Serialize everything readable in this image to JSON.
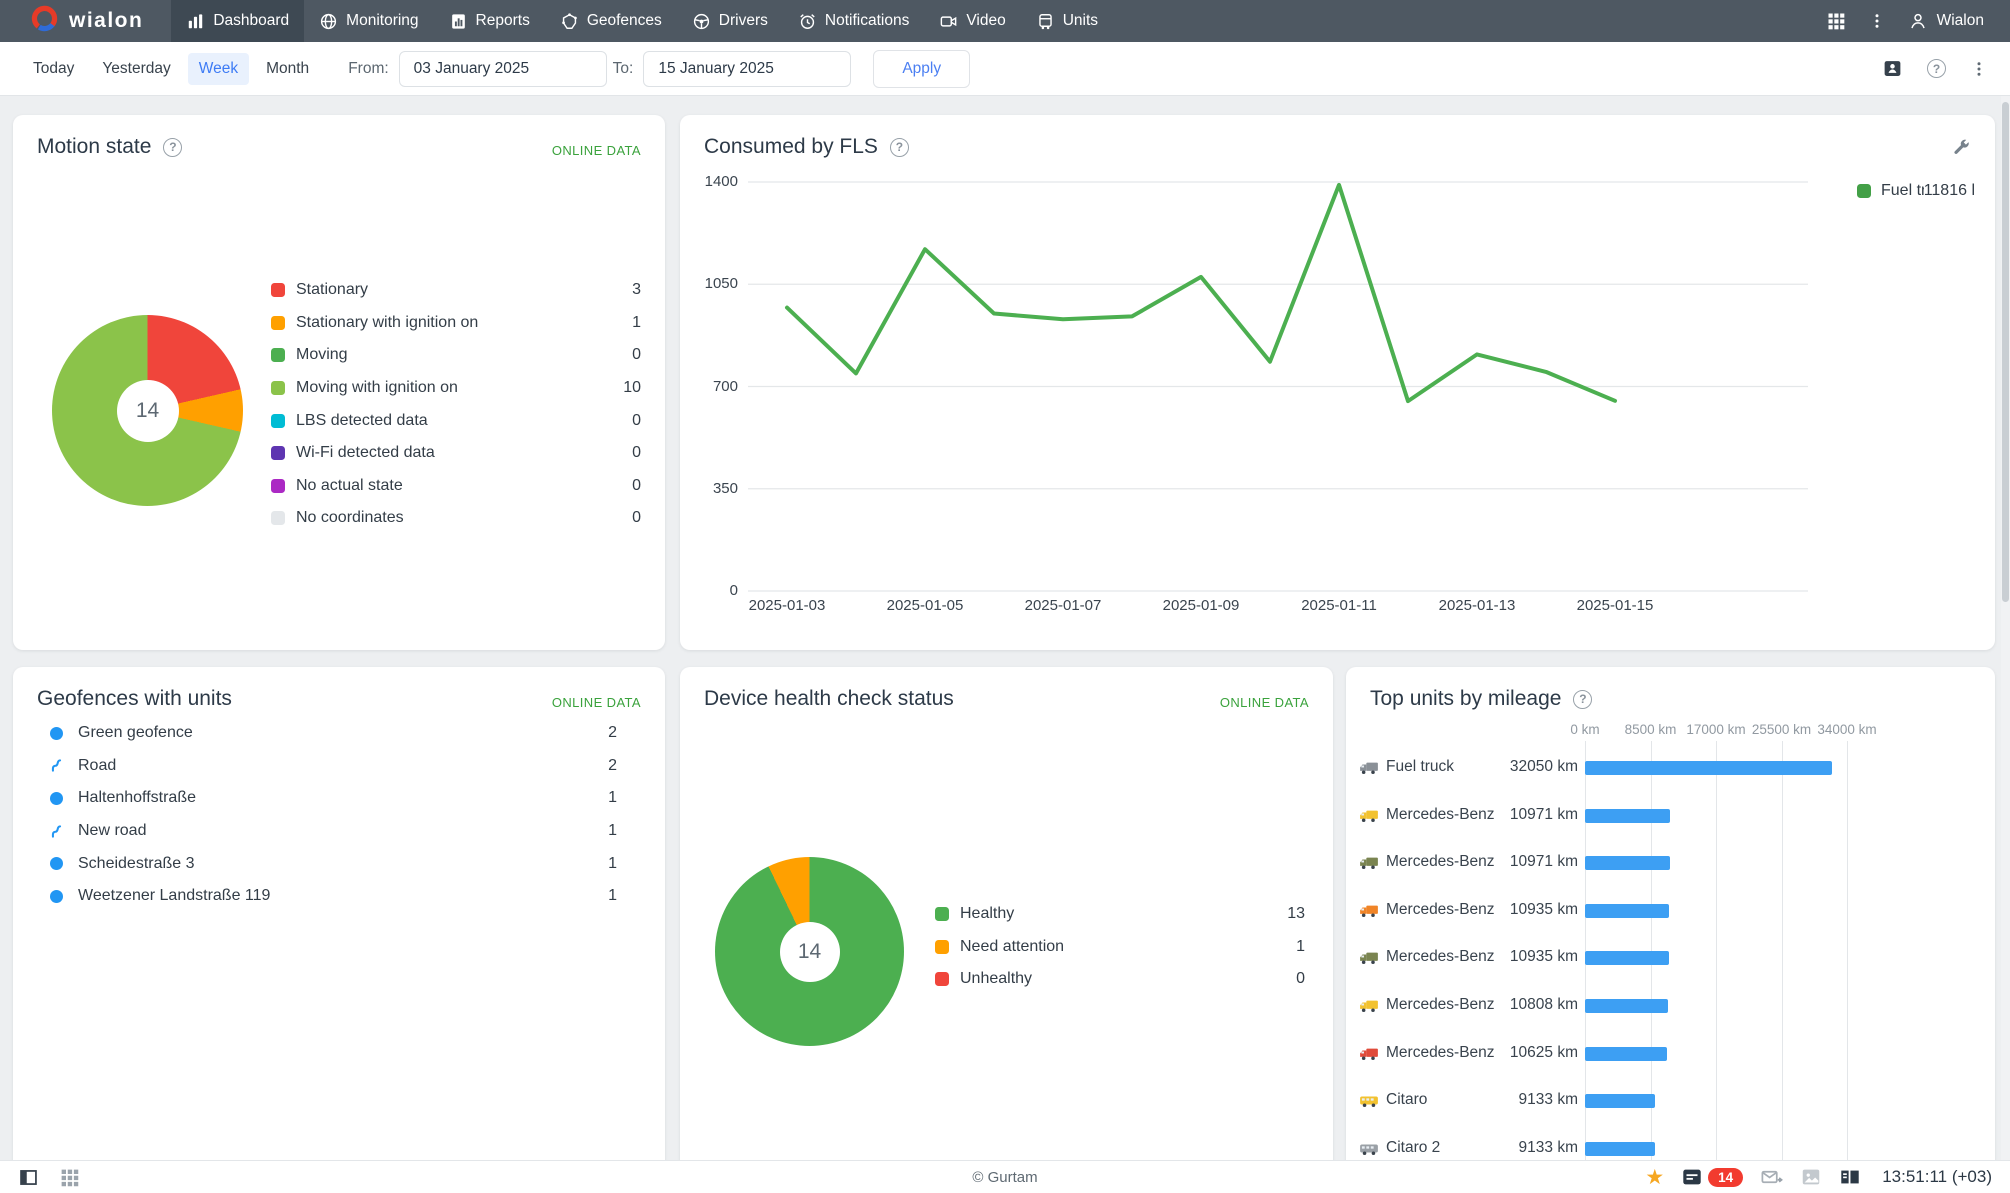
{
  "nav": {
    "brand": "wialon",
    "items": [
      {
        "label": "Dashboard",
        "icon": "dashboard",
        "active": true
      },
      {
        "label": "Monitoring",
        "icon": "monitoring",
        "active": false
      },
      {
        "label": "Reports",
        "icon": "reports",
        "active": false
      },
      {
        "label": "Geofences",
        "icon": "geofences",
        "active": false
      },
      {
        "label": "Drivers",
        "icon": "drivers",
        "active": false
      },
      {
        "label": "Notifications",
        "icon": "notifications",
        "active": false
      },
      {
        "label": "Video",
        "icon": "video",
        "active": false
      },
      {
        "label": "Units",
        "icon": "units",
        "active": false
      }
    ],
    "user_label": "Wialon"
  },
  "filter_bar": {
    "presets": [
      {
        "label": "Today",
        "active": false
      },
      {
        "label": "Yesterday",
        "active": false
      },
      {
        "label": "Week",
        "active": true
      },
      {
        "label": "Month",
        "active": false
      }
    ],
    "from_label": "From:",
    "from_value": "03 January 2025",
    "to_label": "To:",
    "to_value": "15 January 2025",
    "apply_label": "Apply"
  },
  "cards": {
    "motion_state": {
      "title": "Motion state",
      "online_label": "ONLINE DATA",
      "center_label": "14",
      "legend": [
        {
          "label": "Stationary",
          "value": "3",
          "color": "#f0453b"
        },
        {
          "label": "Stationary with ignition on",
          "value": "1",
          "color": "#ffa000"
        },
        {
          "label": "Moving",
          "value": "0",
          "color": "#4caf50"
        },
        {
          "label": "Moving with ignition on",
          "value": "10",
          "color": "#8bc34a"
        },
        {
          "label": "LBS detected data",
          "value": "0",
          "color": "#00bcd4"
        },
        {
          "label": "Wi-Fi detected data",
          "value": "0",
          "color": "#5e35b1"
        },
        {
          "label": "No actual state",
          "value": "0",
          "color": "#ab29c4"
        },
        {
          "label": "No coordinates",
          "value": "0",
          "color": "#e4e7ea"
        }
      ]
    },
    "consumed_fls": {
      "title": "Consumed by FLS",
      "legend_name": "Fuel truck",
      "legend_value": "11816 l",
      "line_color": "#4caf50",
      "dates": [
        "2025-01-03",
        "2025-01-04",
        "2025-01-05",
        "2025-01-06",
        "2025-01-07",
        "2025-01-08",
        "2025-01-09",
        "2025-01-10",
        "2025-01-11",
        "2025-01-12",
        "2025-01-13",
        "2025-01-14",
        "2025-01-15"
      ],
      "values": [
        970,
        745,
        1170,
        950,
        930,
        940,
        1075,
        785,
        1390,
        650,
        810,
        750,
        651
      ],
      "yticks": [
        1400,
        1050,
        700,
        350,
        0
      ]
    },
    "geofences": {
      "title": "Geofences with units",
      "online_label": "ONLINE DATA",
      "rows": [
        {
          "icon": "circle",
          "label": "Green geofence",
          "value": "2"
        },
        {
          "icon": "route",
          "label": "Road",
          "value": "2"
        },
        {
          "icon": "circle",
          "label": "Haltenhoffstraße",
          "value": "1"
        },
        {
          "icon": "route",
          "label": "New road",
          "value": "1"
        },
        {
          "icon": "circle",
          "label": "Scheidestraße 3",
          "value": "1"
        },
        {
          "icon": "circle",
          "label": "Weetzener Landstraße 119",
          "value": "1"
        }
      ]
    },
    "device_health": {
      "title": "Device health check status",
      "online_label": "ONLINE DATA",
      "center_label": "14",
      "legend": [
        {
          "label": "Healthy",
          "value": "13",
          "color": "#4caf50"
        },
        {
          "label": "Need attention",
          "value": "1",
          "color": "#ffa000"
        },
        {
          "label": "Unhealthy",
          "value": "0",
          "color": "#f0453b"
        }
      ]
    },
    "top_mileage": {
      "title": "Top units by mileage",
      "xticks": [
        "0 km",
        "8500 km",
        "17000 km",
        "25500 km",
        "34000 km"
      ],
      "xmax": 34000,
      "bar_color": "#3d9ff3",
      "rows": [
        {
          "label": "Fuel truck",
          "value": "32050 km",
          "km": 32050,
          "vehicle": "truck",
          "icon_color": "#8a9097"
        },
        {
          "label": "Mercedes-Benz",
          "value": "10971 km",
          "km": 10971,
          "vehicle": "truck",
          "icon_color": "#f2c230"
        },
        {
          "label": "Mercedes-Benz",
          "value": "10971 km",
          "km": 10971,
          "vehicle": "truck",
          "icon_color": "#7a8450"
        },
        {
          "label": "Mercedes-Benz",
          "value": "10935 km",
          "km": 10935,
          "vehicle": "truck",
          "icon_color": "#f08427"
        },
        {
          "label": "Mercedes-Benz",
          "value": "10935 km",
          "km": 10935,
          "vehicle": "truck",
          "icon_color": "#7a8450"
        },
        {
          "label": "Mercedes-Benz",
          "value": "10808 km",
          "km": 10808,
          "vehicle": "truck",
          "icon_color": "#f2c230"
        },
        {
          "label": "Mercedes-Benz",
          "value": "10625 km",
          "km": 10625,
          "vehicle": "truck",
          "icon_color": "#e04b3a"
        },
        {
          "label": "Citaro",
          "value": "9133 km",
          "km": 9133,
          "vehicle": "bus",
          "icon_color": "#f2c230"
        },
        {
          "label": "Citaro 2",
          "value": "9133 km",
          "km": 9133,
          "vehicle": "bus",
          "icon_color": "#9aa0a6"
        }
      ]
    }
  },
  "footer": {
    "copyright": "© Gurtam",
    "badge": "14",
    "time": "13:51:11 (+03)"
  },
  "chart_data": [
    {
      "type": "pie",
      "title": "Motion state",
      "labels": [
        "Stationary",
        "Stationary with ignition on",
        "Moving",
        "Moving with ignition on",
        "LBS detected data",
        "Wi-Fi detected data",
        "No actual state",
        "No coordinates"
      ],
      "values": [
        3,
        1,
        0,
        10,
        0,
        0,
        0,
        0
      ],
      "center_label": "14"
    },
    {
      "type": "line",
      "title": "Consumed by FLS",
      "x": [
        "2025-01-03",
        "2025-01-04",
        "2025-01-05",
        "2025-01-06",
        "2025-01-07",
        "2025-01-08",
        "2025-01-09",
        "2025-01-10",
        "2025-01-11",
        "2025-01-12",
        "2025-01-13",
        "2025-01-14",
        "2025-01-15"
      ],
      "series": [
        {
          "name": "Fuel truck",
          "values": [
            970,
            745,
            1170,
            950,
            930,
            940,
            1075,
            785,
            1390,
            650,
            810,
            750,
            651
          ],
          "total_label": "11816 l"
        }
      ],
      "ylim": [
        0,
        1400
      ],
      "yticks": [
        0,
        350,
        700,
        1050,
        1400
      ],
      "legend_position": "right"
    },
    {
      "type": "pie",
      "title": "Device health check status",
      "labels": [
        "Healthy",
        "Need attention",
        "Unhealthy"
      ],
      "values": [
        13,
        1,
        0
      ],
      "center_label": "14"
    },
    {
      "type": "bar",
      "title": "Top units by mileage",
      "orientation": "horizontal",
      "categories": [
        "Fuel truck",
        "Mercedes-Benz",
        "Mercedes-Benz",
        "Mercedes-Benz",
        "Mercedes-Benz",
        "Mercedes-Benz",
        "Mercedes-Benz",
        "Citaro",
        "Citaro 2"
      ],
      "values": [
        32050,
        10971,
        10971,
        10935,
        10935,
        10808,
        10625,
        9133,
        9133
      ],
      "xlim": [
        0,
        34000
      ],
      "xticks": [
        0,
        8500,
        17000,
        25500,
        34000
      ],
      "unit": "km"
    }
  ]
}
